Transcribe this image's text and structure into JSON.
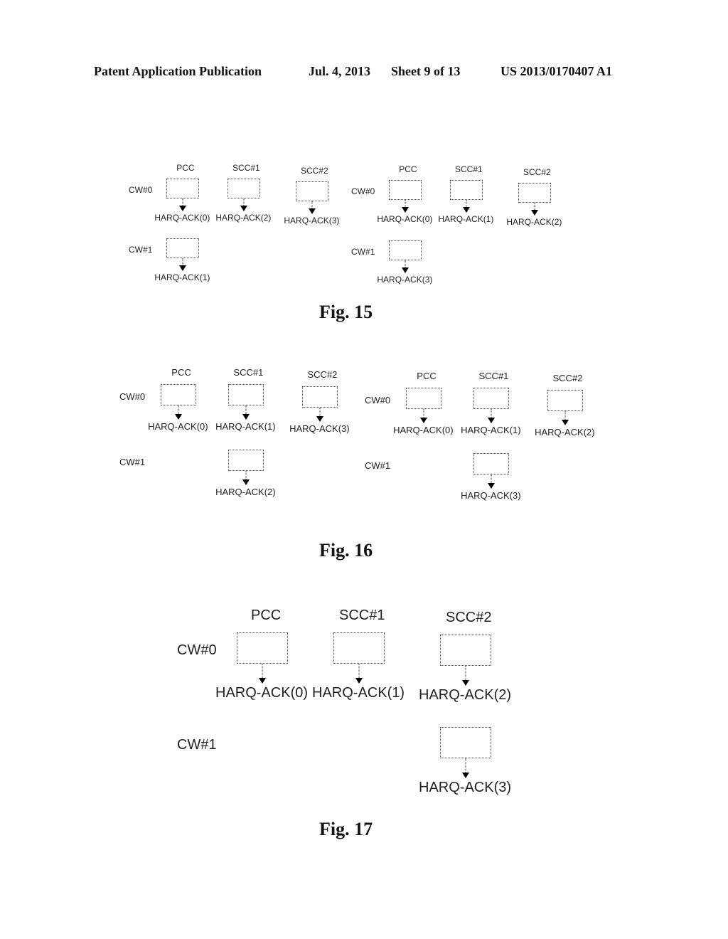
{
  "header": {
    "left": "Patent Application Publication",
    "date": "Jul. 4, 2013",
    "sheet": "Sheet 9 of 13",
    "number": "US 2013/0170407 A1"
  },
  "figures": [
    {
      "caption": "Fig. 15",
      "panels": [
        {
          "columns": [
            "PCC",
            "SCC#1",
            "SCC#2"
          ],
          "rows": [
            "CW#0",
            "CW#1"
          ],
          "cells": [
            {
              "column": "PCC",
              "row": "CW#0",
              "ack": "HARQ-ACK(0)"
            },
            {
              "column": "SCC#1",
              "row": "CW#0",
              "ack": "HARQ-ACK(2)"
            },
            {
              "column": "SCC#2",
              "row": "CW#0",
              "ack": "HARQ-ACK(3)"
            },
            {
              "column": "PCC",
              "row": "CW#1",
              "ack": "HARQ-ACK(1)"
            }
          ]
        },
        {
          "columns": [
            "PCC",
            "SCC#1",
            "SCC#2"
          ],
          "rows": [
            "CW#0",
            "CW#1"
          ],
          "cells": [
            {
              "column": "PCC",
              "row": "CW#0",
              "ack": "HARQ-ACK(0)"
            },
            {
              "column": "SCC#1",
              "row": "CW#0",
              "ack": "HARQ-ACK(1)"
            },
            {
              "column": "SCC#2",
              "row": "CW#0",
              "ack": "HARQ-ACK(2)"
            },
            {
              "column": "PCC",
              "row": "CW#1",
              "ack": "HARQ-ACK(3)"
            }
          ]
        }
      ]
    },
    {
      "caption": "Fig. 16",
      "panels": [
        {
          "columns": [
            "PCC",
            "SCC#1",
            "SCC#2"
          ],
          "rows": [
            "CW#0",
            "CW#1"
          ],
          "cells": [
            {
              "column": "PCC",
              "row": "CW#0",
              "ack": "HARQ-ACK(0)"
            },
            {
              "column": "SCC#1",
              "row": "CW#0",
              "ack": "HARQ-ACK(1)"
            },
            {
              "column": "SCC#2",
              "row": "CW#0",
              "ack": "HARQ-ACK(3)"
            },
            {
              "column": "SCC#1",
              "row": "CW#1",
              "ack": "HARQ-ACK(2)"
            }
          ]
        },
        {
          "columns": [
            "PCC",
            "SCC#1",
            "SCC#2"
          ],
          "rows": [
            "CW#0",
            "CW#1"
          ],
          "cells": [
            {
              "column": "PCC",
              "row": "CW#0",
              "ack": "HARQ-ACK(0)"
            },
            {
              "column": "SCC#1",
              "row": "CW#0",
              "ack": "HARQ-ACK(1)"
            },
            {
              "column": "SCC#2",
              "row": "CW#0",
              "ack": "HARQ-ACK(2)"
            },
            {
              "column": "SCC#1",
              "row": "CW#1",
              "ack": "HARQ-ACK(3)"
            }
          ]
        }
      ]
    },
    {
      "caption": "Fig. 17",
      "panels": [
        {
          "columns": [
            "PCC",
            "SCC#1",
            "SCC#2"
          ],
          "rows": [
            "CW#0",
            "CW#1"
          ],
          "cells": [
            {
              "column": "PCC",
              "row": "CW#0",
              "ack": "HARQ-ACK(0)"
            },
            {
              "column": "SCC#1",
              "row": "CW#0",
              "ack": "HARQ-ACK(1)"
            },
            {
              "column": "SCC#2",
              "row": "CW#0",
              "ack": "HARQ-ACK(2)"
            },
            {
              "column": "SCC#2",
              "row": "CW#1",
              "ack": "HARQ-ACK(3)"
            }
          ]
        }
      ]
    }
  ]
}
